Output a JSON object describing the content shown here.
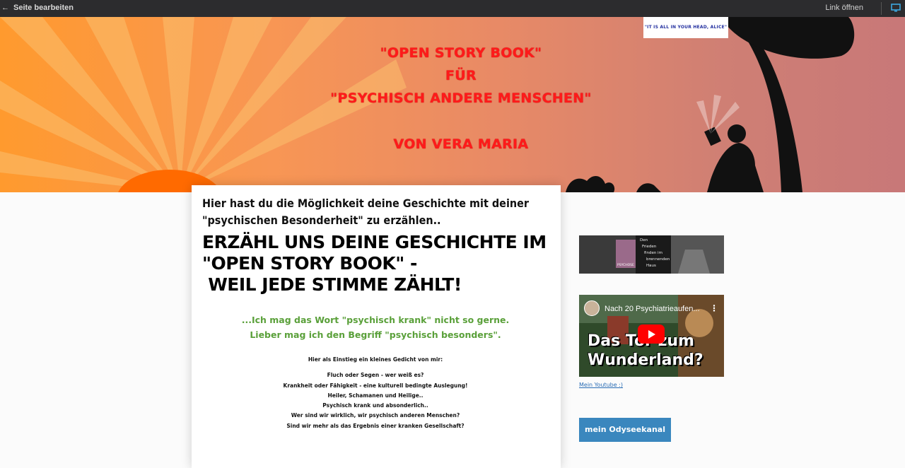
{
  "topbar": {
    "back_label": "Seite bearbeiten",
    "link_open_label": "Link öffnen"
  },
  "hero": {
    "lines": [
      "\"OPEN STORY BOOK\"",
      "FÜR",
      "\"PSYCHISCH ANDERE MENSCHEN\"",
      "VON VERA MARIA"
    ],
    "stamp_text": "\"IT IS ALL IN YOUR HEAD, ALICE\"",
    "title_color": "#ff1a1a"
  },
  "card": {
    "intro": "Hier hast du die Möglichkeit deine Geschichte mit deiner \"psychischen Besonderheit\" zu erzählen..",
    "headline": "ERZÄHL UNS DEINE GESCHICHTE IM\n\"OPEN STORY BOOK\" -\n WEIL JEDE STIMME ZÄHLT!",
    "quote_line1": "...Ich mag das Wort \"psychisch krank\" nicht so gerne.",
    "quote_line2": "Lieber mag ich den Begriff \"psychisch besonders\".",
    "poem_intro": "Hier als Einstieg ein kleines Gedicht von mir:",
    "poem_lines": [
      "Fluch oder Segen - wer weiß es?",
      "Krankheit oder Fähigkeit - eine kulturell bedingte Auslegung!",
      "Heiler, Schamanen und Heilige..",
      "Psychisch krank und absonderlich..",
      "Wer sind wir wirklich, wir psychisch anderen Menschen?",
      "Sind wir mehr als das Ergebnis einer kranken Gesellschaft?"
    ],
    "accent_color": "#5aa03a"
  },
  "sidebar": {
    "thumb_text": [
      "Den",
      "Frieden",
      "finden im",
      "brennenden",
      "Haus"
    ],
    "thumb_badge": "PSYCHOSE",
    "video_title": "Nach 20 Psychiatrieaufen...",
    "video_big_text": "Das Tor zum\nWunderland?",
    "youtube_link": "Mein Youtube :)",
    "odysee_button": "mein Odyseekanal"
  }
}
